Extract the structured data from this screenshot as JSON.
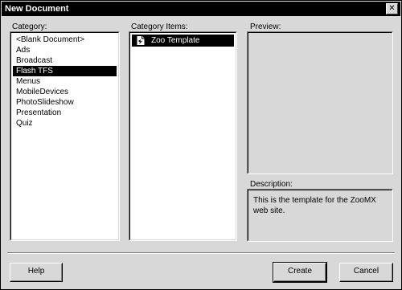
{
  "window": {
    "title": "New Document",
    "close_glyph": "✕",
    "close_icon": "close-icon"
  },
  "category": {
    "label": "Category:",
    "items": [
      {
        "label": "<Blank Document>",
        "selected": false
      },
      {
        "label": "Ads",
        "selected": false
      },
      {
        "label": "Broadcast",
        "selected": false
      },
      {
        "label": "Flash TFS",
        "selected": true
      },
      {
        "label": "Menus",
        "selected": false
      },
      {
        "label": "MobileDevices",
        "selected": false
      },
      {
        "label": "PhotoSlideshow",
        "selected": false
      },
      {
        "label": "Presentation",
        "selected": false
      },
      {
        "label": "Quiz",
        "selected": false
      }
    ]
  },
  "category_items": {
    "label": "Category Items:",
    "items": [
      {
        "label": "Zoo Template",
        "icon": "template-file-icon",
        "selected": true
      }
    ]
  },
  "preview": {
    "label": "Preview:"
  },
  "description": {
    "label": "Description:",
    "text": "This is the template for the ZooMX web site."
  },
  "buttons": {
    "help": "Help",
    "create": "Create",
    "cancel": "Cancel"
  },
  "colors": {
    "title_bar": "#000000",
    "dialog_face": "#d8d8d8",
    "selection": "#000000",
    "list_background": "#ffffff"
  }
}
